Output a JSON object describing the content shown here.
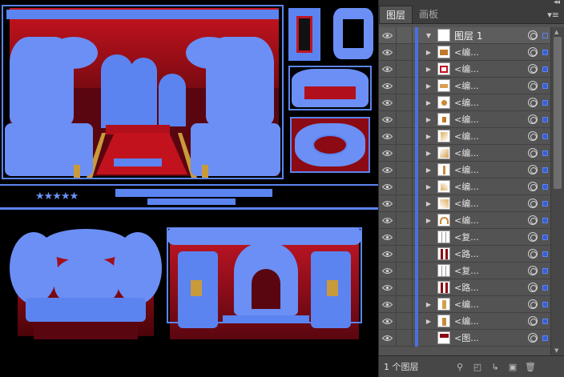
{
  "panel": {
    "tabs": [
      {
        "label": "图层",
        "active": true
      },
      {
        "label": "画板",
        "active": false
      }
    ],
    "collapse_icon": "double-chevron-left-icon",
    "menu_icon": "panel-menu-icon"
  },
  "layers": {
    "top_layer": {
      "name": "图层 1",
      "expanded": true
    },
    "rows": [
      {
        "name": "<编...",
        "has_arrow": true
      },
      {
        "name": "<编...",
        "has_arrow": true
      },
      {
        "name": "<编...",
        "has_arrow": true
      },
      {
        "name": "<编...",
        "has_arrow": true
      },
      {
        "name": "<编...",
        "has_arrow": true
      },
      {
        "name": "<编...",
        "has_arrow": true
      },
      {
        "name": "<编...",
        "has_arrow": true
      },
      {
        "name": "<编...",
        "has_arrow": true
      },
      {
        "name": "<编...",
        "has_arrow": true
      },
      {
        "name": "<编...",
        "has_arrow": true
      },
      {
        "name": "<编...",
        "has_arrow": true
      },
      {
        "name": "<复...",
        "has_arrow": false
      },
      {
        "name": "<路...",
        "has_arrow": false
      },
      {
        "name": "<复...",
        "has_arrow": false
      },
      {
        "name": "<路...",
        "has_arrow": false
      },
      {
        "name": "<编...",
        "has_arrow": true
      },
      {
        "name": "<编...",
        "has_arrow": true
      },
      {
        "name": "<图...",
        "has_arrow": false
      }
    ]
  },
  "footer": {
    "layer_count": "1 个图层",
    "icons": [
      "locate-object-icon",
      "make-clipping-mask-icon",
      "create-sublayer-icon",
      "new-layer-icon",
      "delete-icon"
    ]
  },
  "colors": {
    "selection": "#5b84f0",
    "panel_bg": "#535353",
    "canvas_bg": "#000000",
    "stage_red": "#9b0b16"
  }
}
